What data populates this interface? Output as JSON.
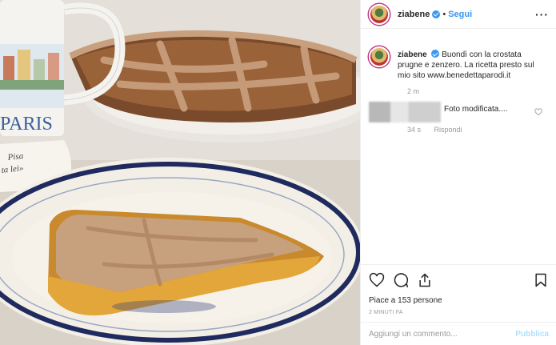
{
  "header": {
    "username": "ziabene",
    "separator": "•",
    "follow_label": "Segui",
    "more_label": "···"
  },
  "caption": {
    "username": "ziabene",
    "text": "Buondì con la crostata prugne e zenzero. La ricetta presto sul mio sito www.benedettaparodi.it",
    "time": "2 m"
  },
  "reply": {
    "text": "Foto modificata....",
    "time": "34 s",
    "reply_label": "Rispondi"
  },
  "actions": {
    "likes": "Piace a 153 persone",
    "time_ago": "2 MINUTI FA"
  },
  "comment_box": {
    "placeholder": "Aggiungi un commento...",
    "publish_label": "Pubblica"
  },
  "photo": {
    "mug_text": "PARIS",
    "book_text_1": "Pisa",
    "book_text_2": "ta lei»"
  },
  "colors": {
    "accent": "#3897f0",
    "text": "#262626",
    "muted": "#999999"
  }
}
